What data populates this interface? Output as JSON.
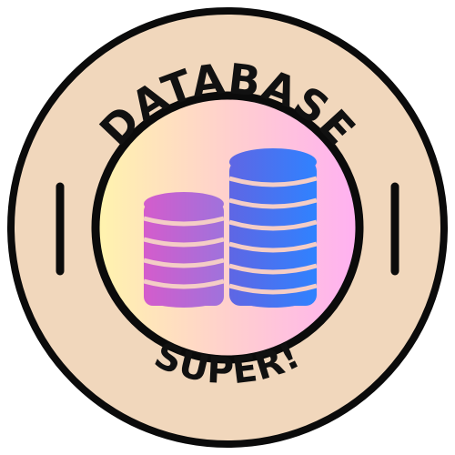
{
  "badge": {
    "top_text": "DATABASE",
    "bottom_text": "SUPER!",
    "colors": {
      "outer_ring": "#f1d7bc",
      "outline": "#0b0b0b",
      "inner_gradient": [
        "#fff4ad",
        "#ffd0cd",
        "#ffb0f2"
      ],
      "small_stack_gradient": [
        "#d45ccc",
        "#9f72dc"
      ],
      "large_stack_gradient": [
        "#5f66e4",
        "#2f82ff"
      ],
      "stack_dividers": "#f4cdc6"
    },
    "icons": {
      "left_mark": "vertical-bar",
      "right_mark": "vertical-bar",
      "center": "database-stack-icon"
    }
  }
}
